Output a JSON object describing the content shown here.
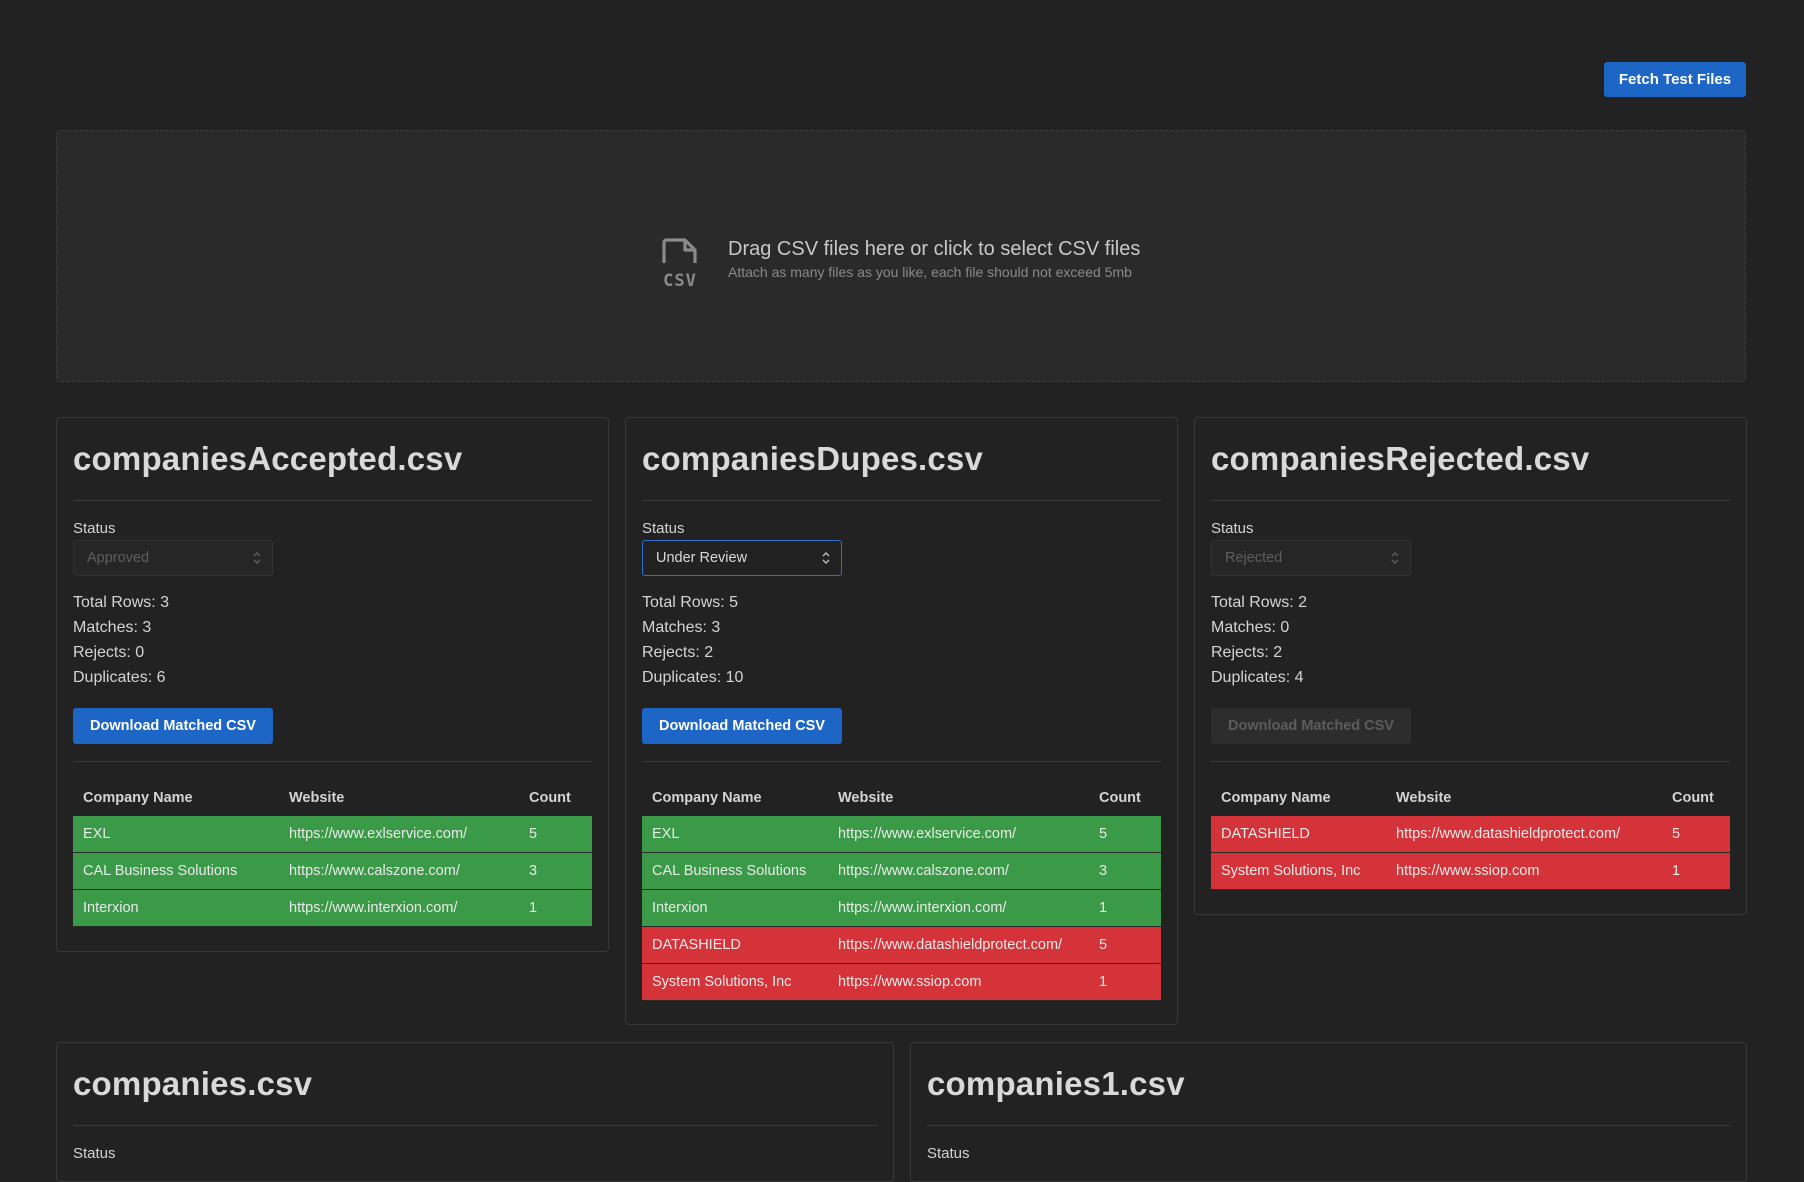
{
  "toolbar": {
    "fetch_label": "Fetch Test Files"
  },
  "dropzone": {
    "title": "Drag CSV files here or click to select CSV files",
    "subtitle": "Attach as many files as you like, each file should not exceed 5mb",
    "icon": "csv-file-icon"
  },
  "colors": {
    "accent": "#1e66c6",
    "match": "#3b9a47",
    "reject": "#d43339",
    "background": "#222222"
  },
  "files": [
    {
      "name": "companiesAccepted.csv",
      "status_label": "Status",
      "status": "Approved",
      "status_enabled": false,
      "stats": {
        "total": "Total Rows: 3",
        "matches": "Matches: 3",
        "rejects": "Rejects: 0",
        "duplicates": "Duplicates: 6"
      },
      "download_label": "Download Matched CSV",
      "download_enabled": true,
      "columns": [
        "Company Name",
        "Website",
        "Count"
      ],
      "rows": [
        {
          "company": "EXL",
          "website": "https://www.exlservice.com/",
          "count": "5",
          "state": "match"
        },
        {
          "company": "CAL Business Solutions",
          "website": "https://www.calszone.com/",
          "count": "3",
          "state": "match"
        },
        {
          "company": "Interxion",
          "website": "https://www.interxion.com/",
          "count": "1",
          "state": "match"
        }
      ]
    },
    {
      "name": "companiesDupes.csv",
      "status_label": "Status",
      "status": "Under Review",
      "status_enabled": true,
      "stats": {
        "total": "Total Rows: 5",
        "matches": "Matches: 3",
        "rejects": "Rejects: 2",
        "duplicates": "Duplicates: 10"
      },
      "download_label": "Download Matched CSV",
      "download_enabled": true,
      "columns": [
        "Company Name",
        "Website",
        "Count"
      ],
      "rows": [
        {
          "company": "EXL",
          "website": "https://www.exlservice.com/",
          "count": "5",
          "state": "match"
        },
        {
          "company": "CAL Business Solutions",
          "website": "https://www.calszone.com/",
          "count": "3",
          "state": "match"
        },
        {
          "company": "Interxion",
          "website": "https://www.interxion.com/",
          "count": "1",
          "state": "match"
        },
        {
          "company": "DATASHIELD",
          "website": "https://www.datashieldprotect.com/",
          "count": "5",
          "state": "reject"
        },
        {
          "company": "System Solutions, Inc",
          "website": "https://www.ssiop.com",
          "count": "1",
          "state": "reject"
        }
      ]
    },
    {
      "name": "companiesRejected.csv",
      "status_label": "Status",
      "status": "Rejected",
      "status_enabled": false,
      "stats": {
        "total": "Total Rows: 2",
        "matches": "Matches: 0",
        "rejects": "Rejects: 2",
        "duplicates": "Duplicates: 4"
      },
      "download_label": "Download Matched CSV",
      "download_enabled": false,
      "columns": [
        "Company Name",
        "Website",
        "Count"
      ],
      "rows": [
        {
          "company": "DATASHIELD",
          "website": "https://www.datashieldprotect.com/",
          "count": "5",
          "state": "reject"
        },
        {
          "company": "System Solutions, Inc",
          "website": "https://www.ssiop.com",
          "count": "1",
          "state": "reject"
        }
      ]
    },
    {
      "name": "companies.csv",
      "status_label": "Status"
    },
    {
      "name": "companies1.csv",
      "status_label": "Status"
    }
  ]
}
